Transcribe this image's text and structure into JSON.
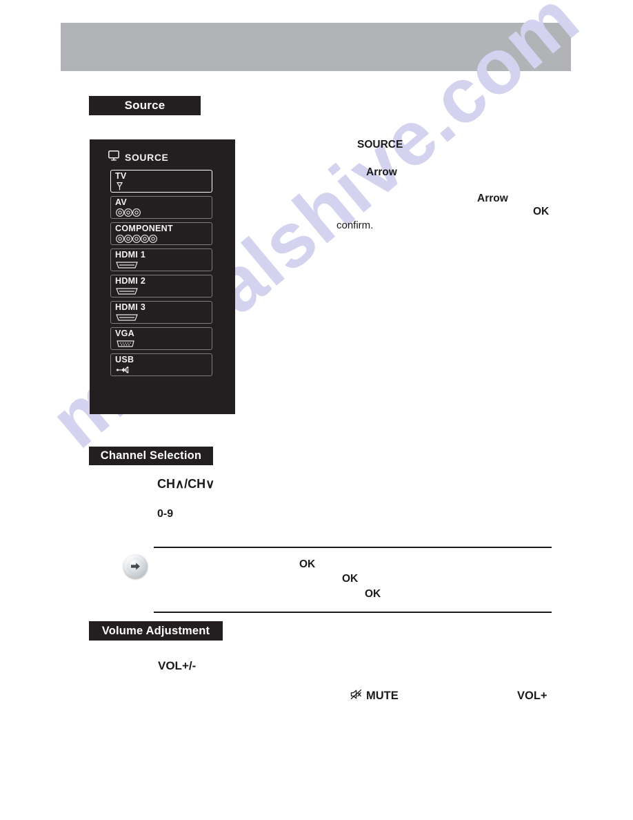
{
  "page": {
    "watermark": "manualshive.com",
    "header_band_color": "#b1b3b6",
    "heading_bar_color": "#231f20",
    "panel_color": "#231f20"
  },
  "sections": {
    "source": {
      "heading": "Source"
    },
    "channel": {
      "heading": "Channel Selection"
    },
    "volume": {
      "heading": "Volume Adjustment"
    }
  },
  "osd": {
    "title": "SOURCE",
    "title_icon": "monitor-icon",
    "items": [
      {
        "label": "TV",
        "icon": "antenna-icon",
        "selected": true
      },
      {
        "label": "AV",
        "icon": "rca-3-icon",
        "selected": false
      },
      {
        "label": "COMPONENT",
        "icon": "rca-5-icon",
        "selected": false
      },
      {
        "label": "HDMI 1",
        "icon": "hdmi-icon",
        "selected": false
      },
      {
        "label": "HDMI 2",
        "icon": "hdmi-icon",
        "selected": false
      },
      {
        "label": "HDMI 3",
        "icon": "hdmi-icon",
        "selected": false
      },
      {
        "label": "VGA",
        "icon": "vga-icon",
        "selected": false
      },
      {
        "label": "USB",
        "icon": "usb-icon",
        "selected": false
      }
    ]
  },
  "source_text": {
    "source_key": "SOURCE",
    "arrow_key_1": "Arrow",
    "arrow_key_2": "Arrow",
    "ok_key": "OK",
    "confirm": "confirm."
  },
  "channel_text": {
    "ch_keys": "CH∧/CH∨",
    "number_keys": "0-9"
  },
  "note": {
    "bullet_icon": "arrow-right-circle-icon",
    "ok_1": "OK",
    "ok_2": "OK",
    "ok_3": "OK"
  },
  "volume_text": {
    "vol_keys": "VOL+/-",
    "mute_icon": "mute-icon",
    "mute_label": "MUTE",
    "vol_plus": "VOL+"
  }
}
